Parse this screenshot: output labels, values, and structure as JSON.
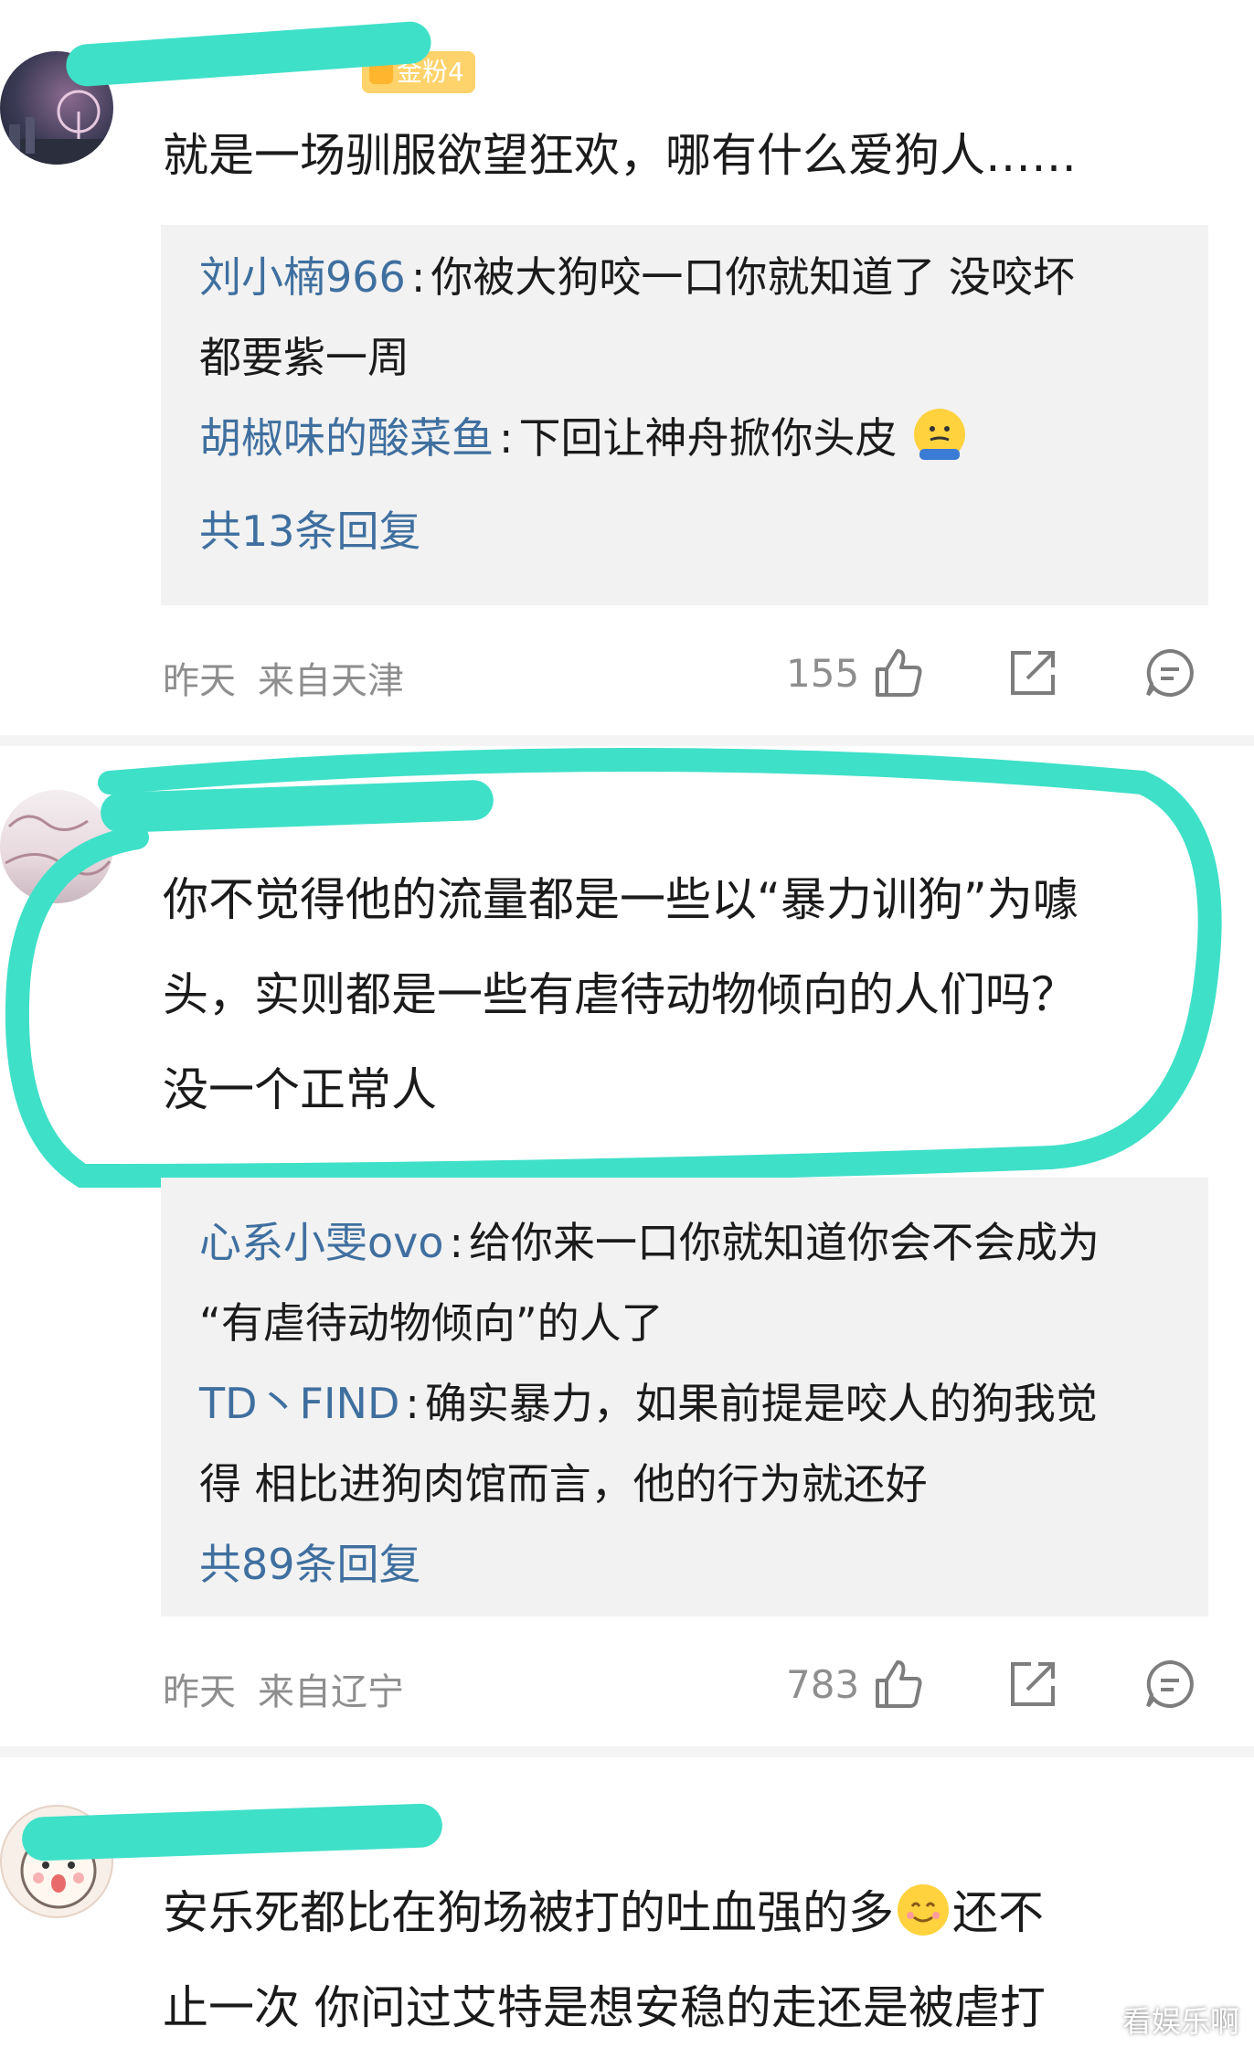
{
  "comments": [
    {
      "badge": "金粉4",
      "lines": [
        "就是一场驯服欲望狂欢，哪有什么爱狗人……"
      ],
      "replies": [
        {
          "user": "刘小楠966",
          "text": [
            "你被大狗咬一口你就知道了 没咬坏",
            "都要紫一周"
          ]
        },
        {
          "user": "胡椒味的酸菜鱼",
          "text": [
            "下回让神舟掀你头皮"
          ],
          "emoji": "shrug-emoji"
        }
      ],
      "more": "共13条回复",
      "time": "昨天",
      "location": "来自天津",
      "likes": "155"
    },
    {
      "lines": [
        "你不觉得他的流量都是一些以“暴力训狗”为噱",
        "头，实则都是一些有虐待动物倾向的人们吗？",
        "没一个正常人"
      ],
      "replies": [
        {
          "user": "心系小雯ovo",
          "text": [
            "给你来一口你就知道你会不会成为",
            "“有虐待动物倾向”的人了"
          ]
        },
        {
          "user": "TD丶FIND",
          "text": [
            "确实暴力，如果前提是咬人的狗我觉",
            "得 相比进狗肉馆而言，他的行为就还好"
          ]
        }
      ],
      "more": "共89条回复",
      "time": "昨天",
      "location": "来自辽宁",
      "likes": "783"
    },
    {
      "lines": [
        "安乐死都比在狗场被打的吐血强的多",
        "止一次 你问过艾特是想安稳的走还是被虐打"
      ],
      "line0_suffix": "还不",
      "emoji": "smile-emoji"
    }
  ],
  "watermark": "看娱乐啊",
  "icons": {
    "like": "thumbs-up-icon",
    "share": "share-icon",
    "comment": "comment-icon"
  },
  "colors": {
    "highlight": "#3fe0c8",
    "link": "#3f6f9f",
    "badge": "#ffd36b"
  }
}
